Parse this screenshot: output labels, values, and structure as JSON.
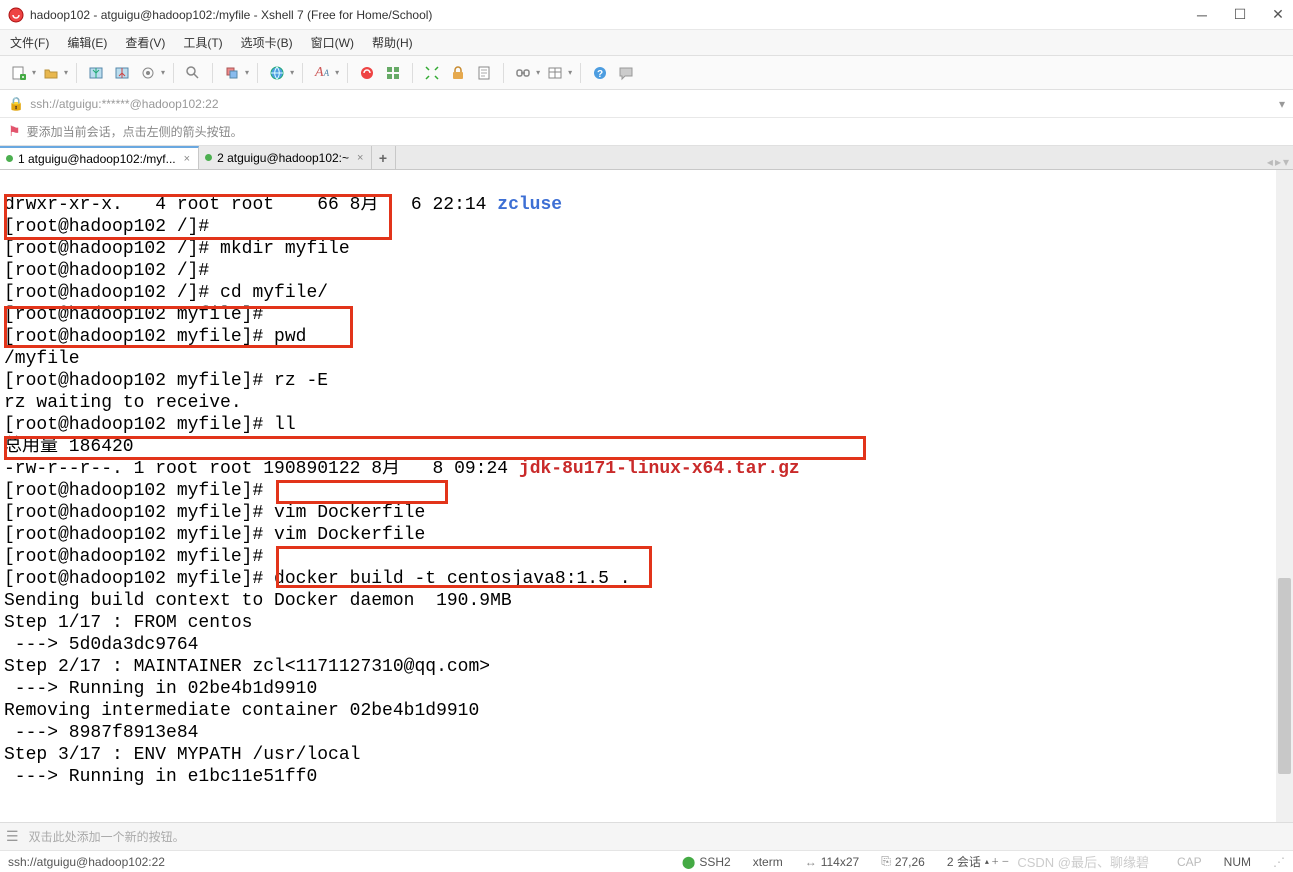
{
  "window": {
    "title": "hadoop102 - atguigu@hadoop102:/myfile - Xshell 7 (Free for Home/School)"
  },
  "menu": {
    "file": "文件(F)",
    "edit": "编辑(E)",
    "view": "查看(V)",
    "tools": "工具(T)",
    "tab": "选项卡(B)",
    "window": "窗口(W)",
    "help": "帮助(H)"
  },
  "address": "ssh://atguigu:******@hadoop102:22",
  "hint": "要添加当前会话，点击左侧的箭头按钮。",
  "tabs": {
    "t1": "1 atguigu@hadoop102:/myf...",
    "t2": "2 atguigu@hadoop102:~"
  },
  "terminal": {
    "l1a": "drwxr-xr-x.   4 root root    66 8月   6 22:14 ",
    "l1b": "zcluse",
    "l2": "[root@hadoop102 /]#",
    "l3": "[root@hadoop102 /]# mkdir myfile",
    "l4": "[root@hadoop102 /]#",
    "l5": "[root@hadoop102 /]# cd myfile/",
    "l6": "[root@hadoop102 myfile]#",
    "l7": "[root@hadoop102 myfile]# pwd",
    "l8": "/myfile",
    "l9": "[root@hadoop102 myfile]# rz -E",
    "l10": "rz waiting to receive.",
    "l11": "[root@hadoop102 myfile]# ll",
    "l12": "总用量 186420",
    "l13a": "-rw-r--r--. 1 root root 190890122 8月   8 09:24 ",
    "l13b": "jdk-8u171-linux-x64.tar.gz",
    "l14": "[root@hadoop102 myfile]#",
    "l15": "[root@hadoop102 myfile]# vim Dockerfile",
    "l16": "[root@hadoop102 myfile]# vim Dockerfile",
    "l17": "[root@hadoop102 myfile]#",
    "l18": "[root@hadoop102 myfile]# docker build -t centosjava8:1.5 .",
    "l19": "Sending build context to Docker daemon  190.9MB",
    "l20": "Step 1/17 : FROM centos",
    "l21": " ---> 5d0da3dc9764",
    "l22": "Step 2/17 : MAINTAINER zcl<1171127310@qq.com>",
    "l23": " ---> Running in 02be4b1d9910",
    "l24": "Removing intermediate container 02be4b1d9910",
    "l25": " ---> 8987f8913e84",
    "l26": "Step 3/17 : ENV MYPATH /usr/local",
    "l27": " ---> Running in e1bc11e51ff0"
  },
  "btnbar": "双击此处添加一个新的按钮。",
  "status": {
    "addr": "ssh://atguigu@hadoop102:22",
    "proto": "SSH2",
    "termtype": "xterm",
    "size": "114x27",
    "pos": "27,26",
    "sessions": "2 会话",
    "cap": "CAP",
    "num": "NUM"
  },
  "watermark": "CSDN @最后、聊缘碧"
}
